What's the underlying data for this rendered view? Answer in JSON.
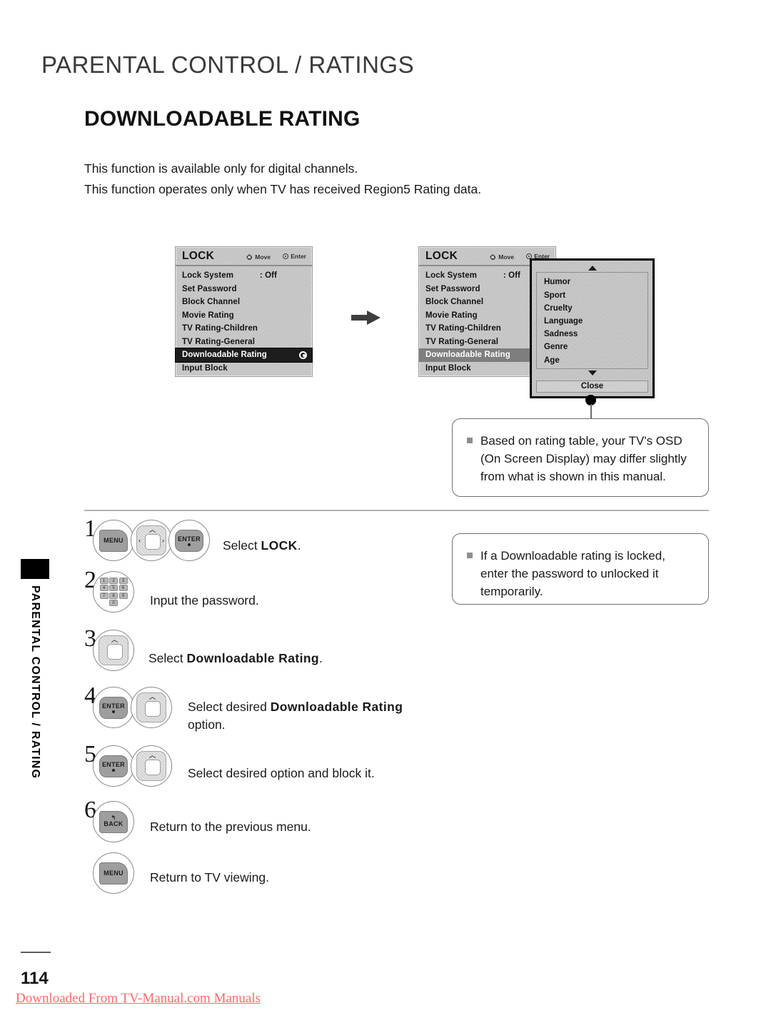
{
  "page": {
    "header_title": "PARENTAL CONTROL / RATINGS",
    "section_title": "DOWNLOADABLE RATING",
    "intro_line_1": "This function is available only for digital channels.",
    "intro_line_2": "This function operates only when TV has received Region5 Rating data.",
    "side_tab_label": "PARENTAL CONTROL / RATING",
    "page_number": "114",
    "watermark": "Downloaded From TV-Manual.com Manuals",
    "accent_watermark_color": "#ff6a6a",
    "highlight_color": "#1d1d1d"
  },
  "osd_menu_1": {
    "title": "LOCK",
    "hint_move": "Move",
    "hint_enter": "Enter",
    "rows": [
      {
        "label": "Lock System",
        "value": ": Off"
      },
      {
        "label": "Set Password",
        "value": ""
      },
      {
        "label": "Block Channel",
        "value": ""
      },
      {
        "label": "Movie Rating",
        "value": ""
      },
      {
        "label": "TV Rating-Children",
        "value": ""
      },
      {
        "label": "TV Rating-General",
        "value": ""
      },
      {
        "label": "Downloadable Rating",
        "value": "",
        "selected": true,
        "radio": true
      },
      {
        "label": "Input Block",
        "value": ""
      }
    ]
  },
  "osd_menu_2": {
    "title": "LOCK",
    "hint_move": "Move",
    "hint_enter": "Enter",
    "rows": [
      {
        "label": "Lock System",
        "value": ": Off"
      },
      {
        "label": "Set Password",
        "value": ""
      },
      {
        "label": "Block Channel",
        "value": ""
      },
      {
        "label": "Movie Rating",
        "value": ""
      },
      {
        "label": "TV Rating-Children",
        "value": ""
      },
      {
        "label": "TV Rating-General",
        "value": ""
      },
      {
        "label": "Downloadable Rating",
        "value": "",
        "selected": true
      },
      {
        "label": "Input Block",
        "value": ""
      }
    ]
  },
  "dropdown": {
    "items": [
      "Humor",
      "Sport",
      "Cruelty",
      "Language",
      "Sadness",
      "Genre",
      "Age"
    ],
    "close_label": "Close",
    "scroll_up_icon": "triangle-up-icon",
    "scroll_down_icon": "triangle-down-icon"
  },
  "callouts": {
    "osd_note": "Based on rating table, your TV's OSD (On Screen Display) may differ slightly from what is shown in this manual.",
    "lock_note": "If a Downloadable rating is locked, enter the password to unlocked it temporarily."
  },
  "steps": [
    {
      "number": "1",
      "buttons": [
        "MENU",
        "D-PAD",
        "ENTER"
      ],
      "text_plain_1": "Select ",
      "text_bold": "LOCK",
      "text_plain_2": "."
    },
    {
      "number": "2",
      "buttons": [
        "NUMBER-KEYPAD"
      ],
      "text_plain_1": "Input the password.",
      "text_bold": "",
      "text_plain_2": ""
    },
    {
      "number": "3",
      "buttons": [
        "UP-DOWN"
      ],
      "text_plain_1": "Select ",
      "text_bold": "Downloadable Rating",
      "text_plain_2": "."
    },
    {
      "number": "4",
      "buttons": [
        "ENTER",
        "UP-DOWN"
      ],
      "text_plain_1": "Select desired ",
      "text_bold": "Downloadable Rating",
      "text_plain_2": " option."
    },
    {
      "number": "5",
      "buttons": [
        "ENTER",
        "UP-DOWN"
      ],
      "text_plain_1": "Select desired option and block it.",
      "text_bold": "",
      "text_plain_2": ""
    },
    {
      "number": "6",
      "buttons": [
        "BACK"
      ],
      "text_plain_1": "Return to the previous menu.",
      "text_bold": "",
      "text_plain_2": ""
    },
    {
      "number": "",
      "buttons": [
        "MENU"
      ],
      "text_plain_1": "Return to TV viewing.",
      "text_bold": "",
      "text_plain_2": ""
    }
  ],
  "keypad": {
    "keys": [
      "1",
      "2",
      "3",
      "4",
      "5",
      "6",
      "7",
      "8",
      "9"
    ],
    "zero": "0"
  },
  "key_labels": {
    "menu": "MENU",
    "enter": "ENTER",
    "back": "BACK"
  }
}
